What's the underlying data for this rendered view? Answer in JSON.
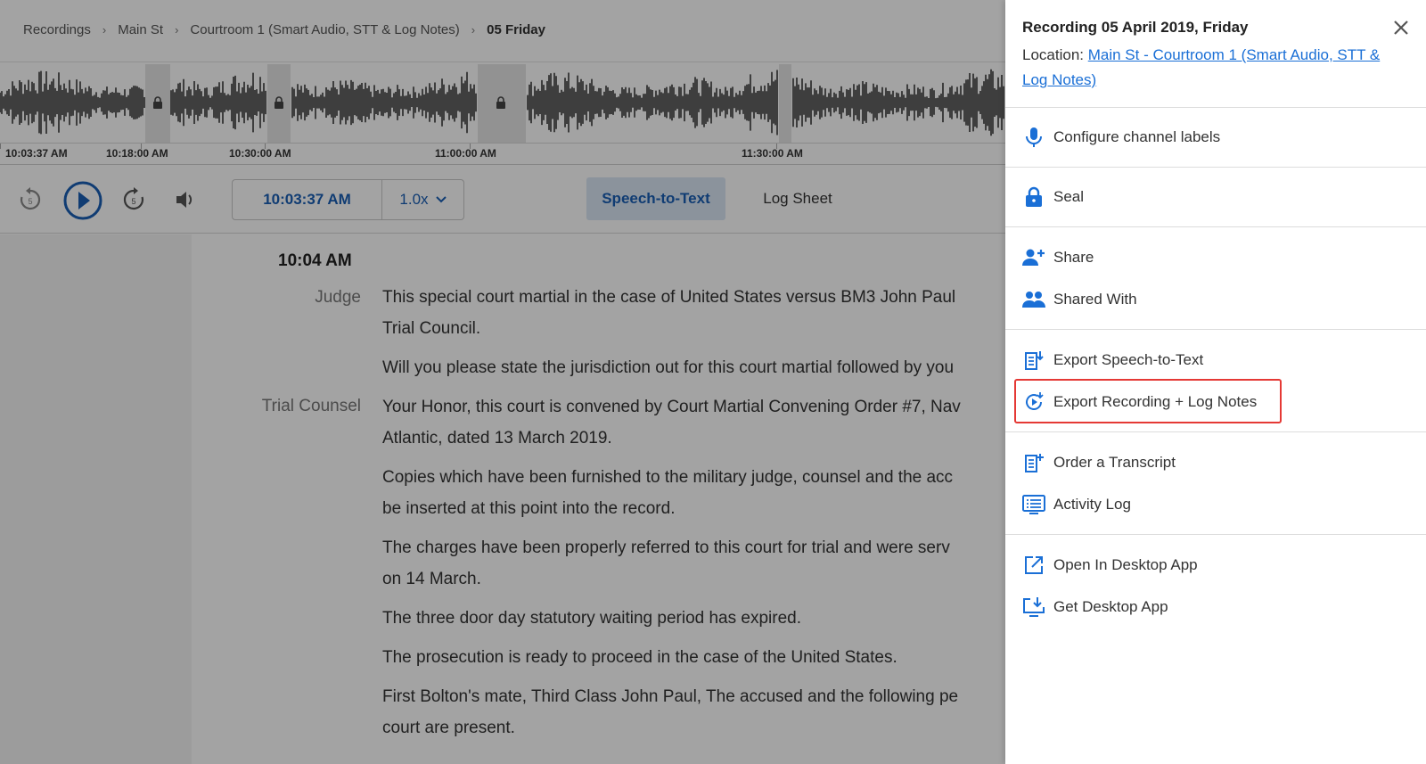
{
  "breadcrumb": {
    "items": [
      "Recordings",
      "Main St",
      "Courtroom 1 (Smart Audio, STT & Log Notes)"
    ],
    "current": "05 Friday"
  },
  "timeline": {
    "labels": [
      "10:03:37 AM",
      "10:18:00 AM",
      "10:30:00 AM",
      "11:00:00 AM",
      "11:30:00 AM"
    ]
  },
  "player": {
    "current_time": "10:03:37 AM",
    "speed": "1.0x",
    "tabs": [
      "Speech-to-Text",
      "Log Sheet"
    ]
  },
  "transcript": {
    "time_header": "10:04 AM",
    "speakers": [
      "Judge",
      "Trial Counsel"
    ],
    "lines": [
      "This special court martial in the case of United States versus BM3 John Paul",
      "Trial Council.",
      "Will you please state the jurisdiction out for this court martial followed by you",
      "Your Honor, this court is convened by Court Martial Convening Order #7, Nav",
      "Atlantic, dated 13 March 2019.",
      "Copies which have been furnished to the military judge, counsel and the acc",
      "be inserted at this point into the record.",
      "The charges have been properly referred to this court for trial and were serv",
      "on 14 March.",
      "The three door day statutory waiting period has expired.",
      "The prosecution is ready to proceed in the case of the United States.",
      "First Bolton's mate, Third Class John Paul, The accused and the following pe",
      "court are present."
    ]
  },
  "panel": {
    "title": "Recording 05 April 2019, Friday",
    "location_label": "Location:",
    "location_link": "Main St - Courtroom 1 (Smart Audio, STT & Log Notes)",
    "menu": [
      {
        "label": "Configure channel labels",
        "icon": "microphone-icon"
      },
      {
        "label": "Seal",
        "icon": "lock-icon"
      },
      {
        "label": "Share",
        "icon": "person-add-icon"
      },
      {
        "label": "Shared With",
        "icon": "people-icon"
      },
      {
        "label": "Export Speech-to-Text",
        "icon": "export-doc-icon"
      },
      {
        "label": "Export Recording + Log Notes",
        "icon": "export-recording-icon"
      },
      {
        "label": "Order a Transcript",
        "icon": "order-doc-icon"
      },
      {
        "label": "Activity Log",
        "icon": "list-icon"
      },
      {
        "label": "Open In Desktop App",
        "icon": "open-external-icon"
      },
      {
        "label": "Get Desktop App",
        "icon": "download-desktop-icon"
      }
    ]
  },
  "colors": {
    "accent": "#1a5fb4",
    "link": "#1a6fd6",
    "highlight": "#e53935",
    "waveform": "#3a3a3a"
  }
}
